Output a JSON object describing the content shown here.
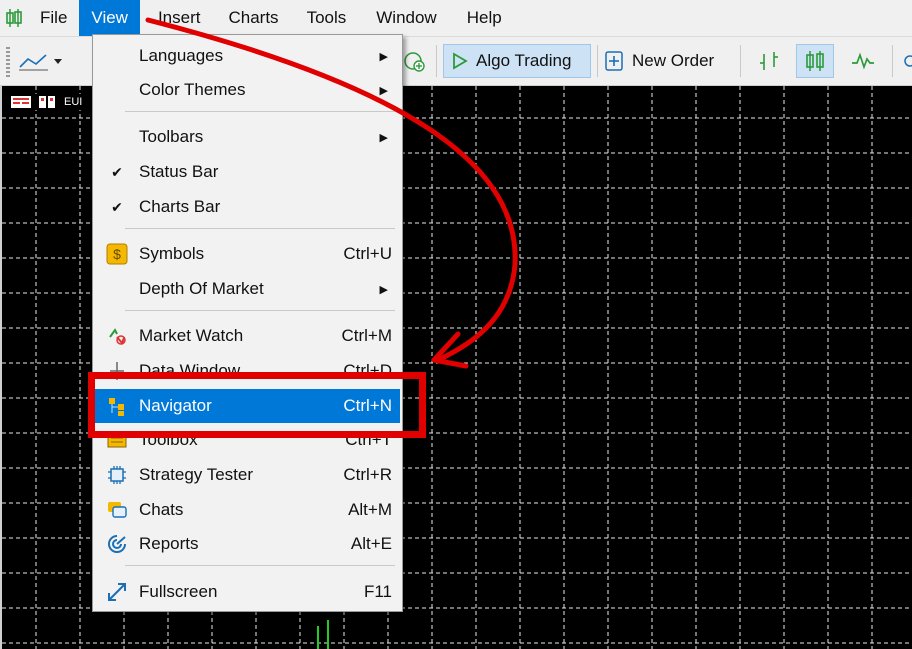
{
  "menubar": {
    "items": [
      "File",
      "View",
      "Insert",
      "Charts",
      "Tools",
      "Window",
      "Help"
    ],
    "active": "View"
  },
  "toolbar": {
    "algo_trading": "Algo Trading",
    "new_order": "New Order"
  },
  "chart": {
    "symbol_label": "EUI"
  },
  "view_menu": {
    "items": [
      {
        "label": "Languages",
        "shortcut": "",
        "submenu": true
      },
      {
        "label": "Color Themes",
        "shortcut": "",
        "submenu": true
      },
      {
        "label": "Toolbars",
        "shortcut": "",
        "submenu": true
      },
      {
        "label": "Status Bar",
        "shortcut": "",
        "checked": true
      },
      {
        "label": "Charts Bar",
        "shortcut": "",
        "checked": true
      },
      {
        "label": "Symbols",
        "shortcut": "Ctrl+U",
        "icon": "symbols-dollar-icon"
      },
      {
        "label": "Depth Of Market",
        "shortcut": "",
        "submenu": true
      },
      {
        "label": "Market Watch",
        "shortcut": "Ctrl+M",
        "icon": "market-watch-icon"
      },
      {
        "label": "Data Window",
        "shortcut": "Ctrl+D",
        "icon": "data-window-icon"
      },
      {
        "label": "Navigator",
        "shortcut": "Ctrl+N",
        "icon": "navigator-icon",
        "selected": true
      },
      {
        "label": "Toolbox",
        "shortcut": "Ctrl+T",
        "icon": "toolbox-icon"
      },
      {
        "label": "Strategy Tester",
        "shortcut": "Ctrl+R",
        "icon": "strategy-tester-icon"
      },
      {
        "label": "Chats",
        "shortcut": "Alt+M",
        "icon": "chats-icon"
      },
      {
        "label": "Reports",
        "shortcut": "Alt+E",
        "icon": "reports-icon"
      },
      {
        "label": "Fullscreen",
        "shortcut": "F11",
        "icon": "fullscreen-icon"
      }
    ],
    "submenu_arrow": "▶",
    "checkmark": "✔"
  },
  "colors": {
    "menu_highlight": "#0078d7",
    "annotation_red": "#e00000",
    "chart_bg": "#000000",
    "grid": "#ffffff"
  }
}
